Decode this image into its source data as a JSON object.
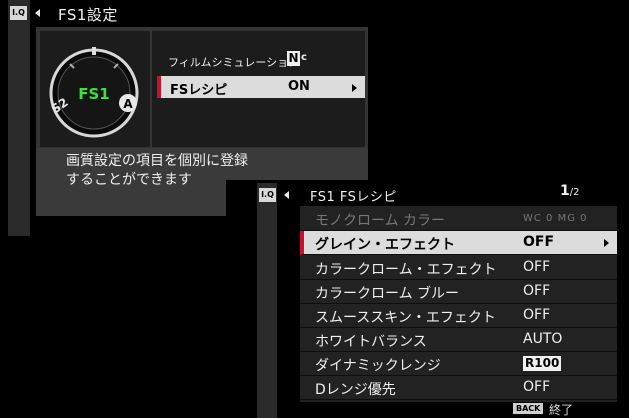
{
  "screen1": {
    "tab_icon": "I.Q",
    "title": "FS1設定",
    "dial": {
      "center": "FS1",
      "left": "S2",
      "right": "A"
    },
    "menu": [
      {
        "label": "フィルムシミュレーション",
        "icon": "film-simulation-nc-icon",
        "icon_text": "N",
        "icon_sub": "c"
      },
      {
        "label": "FSレシピ",
        "value": "ON",
        "selected": true
      }
    ],
    "description": "画質設定の項目を個別に登録\nすることができます"
  },
  "screen2": {
    "tab_icon": "I.Q",
    "title": "FS1  FSレシピ",
    "page_current": "1",
    "page_total": "/2",
    "rows": [
      {
        "label": "モノクローム カラー",
        "value": "WC  0 MG  0",
        "disabled": true
      },
      {
        "label": "グレイン・エフェクト",
        "value": "OFF",
        "selected": true
      },
      {
        "label": "カラークローム・エフェクト",
        "value": "OFF"
      },
      {
        "label": "カラークローム ブルー",
        "value": "OFF"
      },
      {
        "label": "スムーススキン・エフェクト",
        "value": "OFF"
      },
      {
        "label": "ホワイトバランス",
        "value": "AUTO"
      },
      {
        "label": "ダイナミックレンジ",
        "value": "100",
        "value_prefix": "R"
      },
      {
        "label": "Dレンジ優先",
        "value": "OFF"
      }
    ],
    "footer": {
      "back_label": "BACK",
      "end_label": "終了"
    }
  },
  "colors": {
    "accent_red": "#c8102e",
    "fs_green": "#3ce040",
    "selection_bg": "#dcdcdc"
  }
}
